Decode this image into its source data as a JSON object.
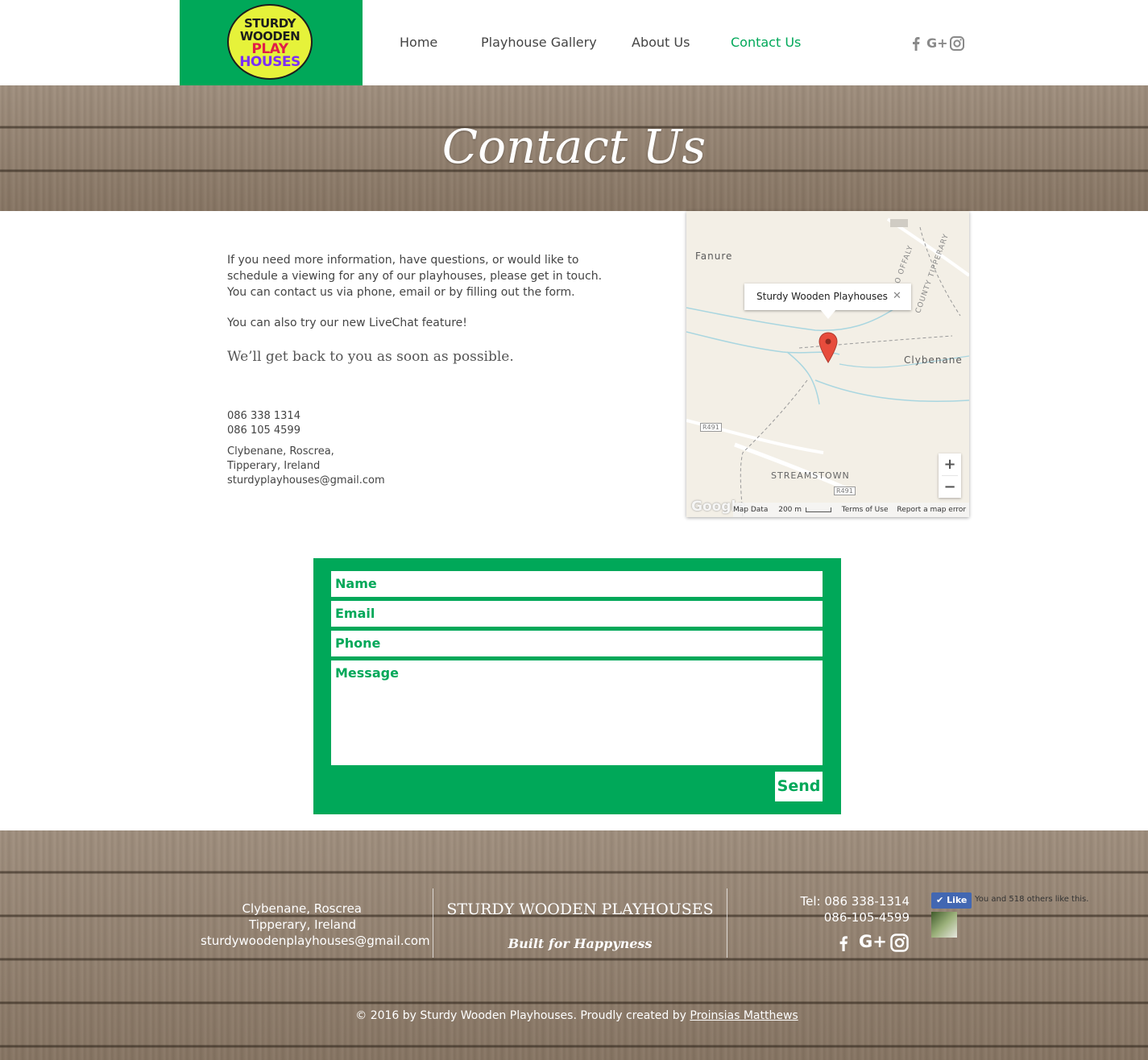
{
  "brand": {
    "logo_lines": [
      "STURDY",
      "WOODEN",
      "PLAY",
      "HOUSES"
    ],
    "colors": {
      "green": "#00a859",
      "yellow": "#e6f23a"
    }
  },
  "nav": {
    "items": [
      {
        "label": "Home"
      },
      {
        "label": "Playhouse Gallery"
      },
      {
        "label": "About Us"
      },
      {
        "label": "Contact Us"
      }
    ],
    "active": "Contact Us",
    "social_icons": [
      "facebook-icon",
      "google-plus-icon",
      "instagram-icon"
    ],
    "google_plus_label": "G+"
  },
  "hero": {
    "title": "Contact Us"
  },
  "info": {
    "paragraph1_lines": [
      "If you need more information, have questions, or would like to",
      "schedule a viewing for any of our playhouses, please get in touch.",
      "You can contact us via phone, email or by filling out the form."
    ],
    "paragraph2": "You can also try our new LiveChat feature!",
    "callout": "We’ll get back to you as soon as possible.",
    "phone1": "086 338 1314",
    "phone2": "086 105 4599",
    "address_line1": "Clybenane, Roscrea,",
    "address_line2": "Tipperary, Ireland",
    "email": "sturdyplayhouses@gmail.com"
  },
  "map": {
    "popup": "Sturdy Wooden Playhouses",
    "popup_close": "✕",
    "places": [
      "Fanure",
      "Clybenane",
      "STREAMSTOWN"
    ],
    "counties": [
      "CO OFFALY",
      "COUNTY TIPPERARY"
    ],
    "roads": [
      "R491",
      "R491"
    ],
    "zoom_in": "+",
    "zoom_out": "−",
    "google_logo": "Google",
    "map_data": "Map Data",
    "scale": "200 m",
    "terms": "Terms of Use",
    "report": "Report a map error"
  },
  "form": {
    "name_placeholder": "Name",
    "email_placeholder": "Email",
    "phone_placeholder": "Phone",
    "message_placeholder": "Message",
    "send_label": "Send"
  },
  "footer": {
    "address_line1": "Clybenane, Roscrea",
    "address_line2": "Tipperary, Ireland",
    "email": "sturdywoodenplayhouses@gmail.com",
    "brand": "STURDY WOODEN PLAYHOUSES",
    "tagline": "Built for Happyness",
    "tel1": "Tel: 086 338-1314",
    "tel2": "086-105-4599",
    "like_label": "Like",
    "like_text": "You and 518 others like this.",
    "google_plus_label": "G+",
    "copyright_prefix": "© 2016 by Sturdy Wooden Playhouses. Proudly created by ",
    "creator": "Proinsias Matthews"
  }
}
